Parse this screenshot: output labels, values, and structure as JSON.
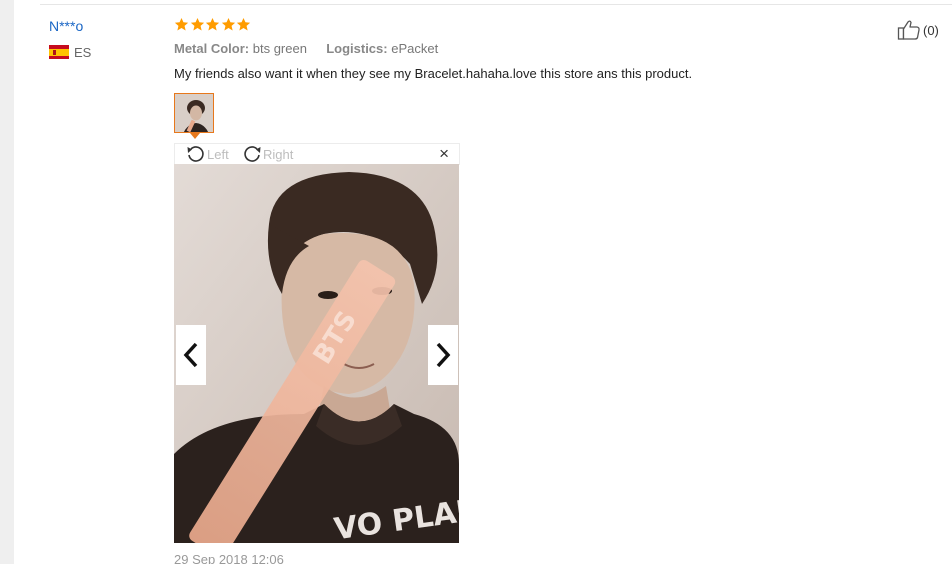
{
  "review": {
    "buyer_name": "N***o",
    "country_code": "ES",
    "rating": 5,
    "attributes": {
      "color_label": "Metal Color:",
      "color_value": "bts green",
      "logistics_label": "Logistics:",
      "logistics_value": "ePacket"
    },
    "text": "My friends also want it when they see my Bracelet.hahaha.love this store ans this product.",
    "date": "29 Sep 2018 12:06",
    "likes": "(0)"
  },
  "viewer": {
    "rotate_left_label": "Left",
    "rotate_right_label": "Right",
    "close_glyph": "×",
    "photo_caption_text": "BTS",
    "photo_shirt_text": "VO PLANET#"
  },
  "colors": {
    "star": "#ff9c00",
    "buyer_link": "#1a66c5",
    "thumb_border": "#e7781c",
    "flag_red": "#c60b1e",
    "flag_yellow": "#ffc400"
  },
  "icons": {
    "stars": "star-icon",
    "like": "thumbs-up-icon",
    "rotate_left": "rotate-ccw-icon",
    "rotate_right": "rotate-cw-icon",
    "prev": "chevron-left-icon",
    "next": "chevron-right-icon",
    "flag": "spain-flag-icon"
  }
}
